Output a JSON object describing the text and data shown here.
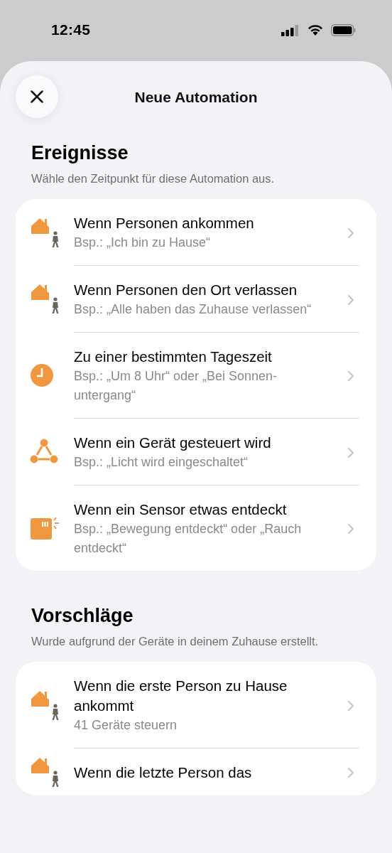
{
  "status_bar": {
    "time": "12:45"
  },
  "sheet": {
    "title": "Neue Automation"
  },
  "sections": [
    {
      "heading": "Ereignisse",
      "subtitle": "Wähle den Zeitpunkt für diese Automation aus.",
      "items": [
        {
          "kind": "home-person",
          "title": "Wenn Personen ankommen",
          "detail": "Bsp.: „Ich bin zu Hause“"
        },
        {
          "kind": "home-person",
          "title": "Wenn Personen den Ort verlassen",
          "detail": "Bsp.: „Alle haben das Zuhause verlassen“"
        },
        {
          "kind": "clock",
          "title": "Zu einer bestimmten Tageszeit",
          "detail": "Bsp.: „Um 8 Uhr“ oder „Bei Sonnen-untergang“"
        },
        {
          "kind": "devices",
          "title": "Wenn ein Gerät gesteuert wird",
          "detail": "Bsp.: „Licht wird eingeschaltet“"
        },
        {
          "kind": "sensor",
          "title": "Wenn ein Sensor etwas entdeckt",
          "detail": "Bsp.: „Bewegung entdeckt“ oder „Rauch entdeckt“"
        }
      ]
    },
    {
      "heading": "Vorschläge",
      "subtitle": "Wurde aufgrund der Geräte in deinem Zuhause erstellt.",
      "items": [
        {
          "kind": "home-person",
          "title": "Wenn die erste Person zu Hause ankommt",
          "detail": "41 Geräte steuern"
        },
        {
          "kind": "home-person",
          "title": "Wenn die letzte Person das"
        }
      ]
    }
  ]
}
